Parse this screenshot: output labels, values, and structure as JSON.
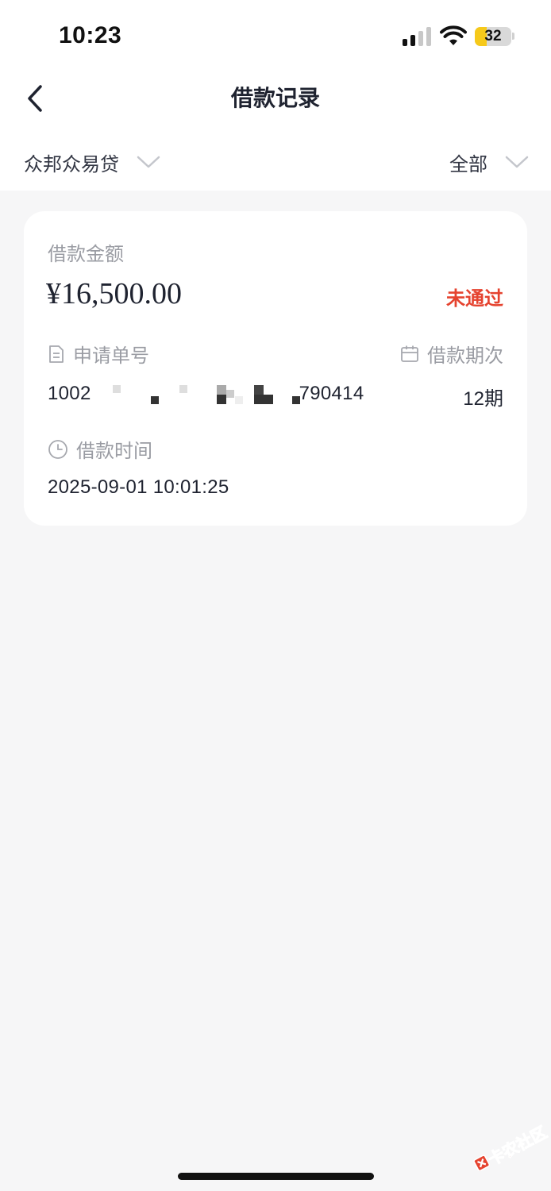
{
  "status_bar": {
    "time": "10:23",
    "battery": "32",
    "battery_level": 0.32
  },
  "nav": {
    "title": "借款记录"
  },
  "filters": {
    "product": {
      "label": "众邦众易贷"
    },
    "status": {
      "label": "全部"
    }
  },
  "record": {
    "amount_label": "借款金额",
    "amount": "¥16,500.00",
    "status": "未通过",
    "order_no_label": "申请单号",
    "order_no_prefix": "1002",
    "order_no_suffix": "790414",
    "term_label": "借款期次",
    "term": "12期",
    "time_label": "借款时间",
    "time": "2025-09-01 10:01:25"
  },
  "watermark": {
    "text": "卡农社区"
  },
  "colors": {
    "status_rejected": "#e5432f",
    "title": "#1f2330",
    "muted": "#9a9ca3"
  }
}
